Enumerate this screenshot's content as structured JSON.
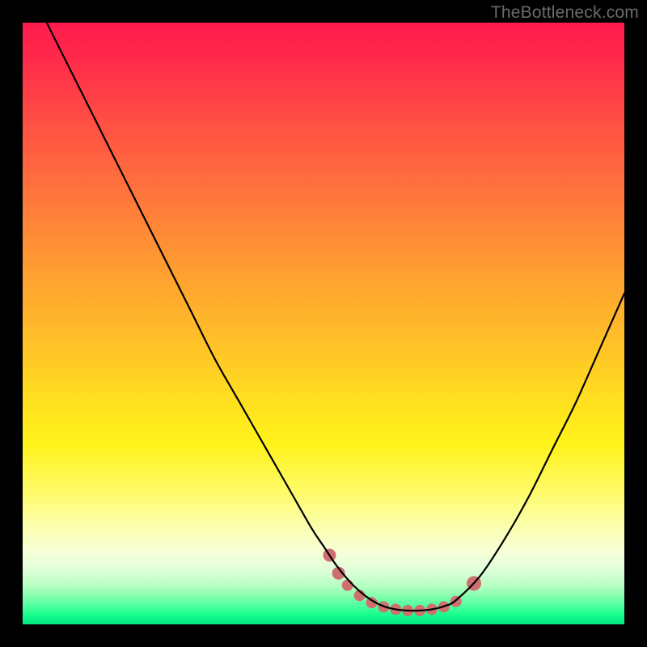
{
  "watermark": "TheBottleneck.com",
  "chart_data": {
    "type": "line",
    "title": "",
    "xlabel": "",
    "ylabel": "",
    "xlim": [
      0,
      100
    ],
    "ylim": [
      0,
      100
    ],
    "grid": false,
    "series": [
      {
        "name": "bottleneck-curve",
        "color": "#000000",
        "x": [
          4,
          8,
          12,
          16,
          20,
          24,
          28,
          32,
          36,
          40,
          44,
          48,
          50,
          52,
          54,
          56,
          58,
          60,
          62,
          64,
          66,
          68,
          70,
          72,
          76,
          80,
          84,
          88,
          92,
          96,
          100
        ],
        "y": [
          100,
          92,
          84,
          76,
          68,
          60,
          52,
          44,
          37,
          30,
          23,
          16,
          13,
          10,
          7.5,
          5.5,
          4,
          3,
          2.5,
          2.3,
          2.3,
          2.5,
          3,
          4,
          8,
          14,
          21,
          29,
          37,
          46,
          55
        ]
      }
    ],
    "markers": {
      "name": "highlight-dots",
      "color": "#cf6f6f",
      "points": [
        {
          "x": 51,
          "y": 11.5,
          "r": 8
        },
        {
          "x": 52.5,
          "y": 8.5,
          "r": 8
        },
        {
          "x": 54,
          "y": 6.5,
          "r": 7
        },
        {
          "x": 56,
          "y": 4.8,
          "r": 7
        },
        {
          "x": 58,
          "y": 3.6,
          "r": 7
        },
        {
          "x": 60,
          "y": 2.9,
          "r": 7
        },
        {
          "x": 62,
          "y": 2.5,
          "r": 7
        },
        {
          "x": 64,
          "y": 2.3,
          "r": 7
        },
        {
          "x": 66,
          "y": 2.3,
          "r": 7
        },
        {
          "x": 68,
          "y": 2.5,
          "r": 7
        },
        {
          "x": 70,
          "y": 2.9,
          "r": 7
        },
        {
          "x": 72,
          "y": 3.8,
          "r": 7
        },
        {
          "x": 75,
          "y": 6.8,
          "r": 9
        }
      ]
    }
  }
}
